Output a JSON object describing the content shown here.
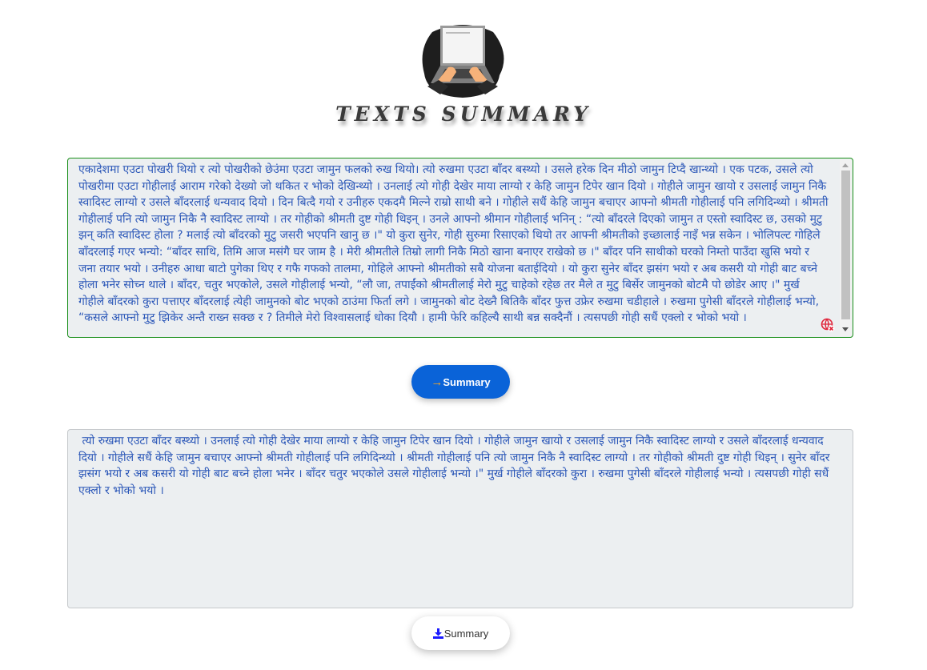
{
  "header": {
    "title": "TEXTS SUMMARY",
    "logo_icon": "laptop-typing-logo"
  },
  "input": {
    "text": "एकादेशमा एउटा पोखरी थियो र त्यो पोखरीको छेउंमा एउटा जामुन फलको रुख थियो। त्यो रुखमा एउटा बाँदर बस्थ्यो । उसले हरेक दिन मीठो जामुन टिप्दै खान्थ्यो । एक पटक, उसले त्यो पोखरीमा एउटा गोहीलाई आराम गरेको देख्यो जो थकित र भोको देखिन्थ्यो । उनलाई त्यो गोही देखेर माया लाग्यो र केहि जामुन टिपेर खान दियो । गोहीले जामुन खायो र उसलाई जामुन निकै स्वादिस्ट लाग्यो र उसले बाँदरलाई धन्यवाद दियो । दिन बित्दै गयो र उनीहरु एकदमै मिल्ने राम्रो साथी बने । गोहीले सधैं केहि जामुन बचाएर आफ्नो श्रीमती गोहीलाई पनि लगिदिन्थ्यो । श्रीमती गोहीलाई पनि त्यो जामुन निकै नै स्वादिस्ट लाग्यो । तर गोहीको श्रीमती दुष्ट गोही थिइन् । उनले आफ्नो श्रीमान गोहीलाई भनिन् : “त्यो बाँदरले दिएको जामुन त एस्तो स्वादिस्ट छ, उसको मुटु झन् कति स्वादिस्ट होला ? मलाई त्यो बाँदरको मुटु जसरी भएपनि खानु छ ।\" यो कुरा सुनेर, गोही सुरुमा रिसाएको थियो तर आफ्नी श्रीमतीको इच्छालाई नाइँ भन्न सकेन । भोलिपल्ट गोहिले बाँदरलाई गएर भन्यो: “बाँदर साथि, तिमि आज मसंगै घर जाम है । मेरी श्रीमतीले तिम्रो लागी निकै मिठो खाना बनाएर राखेको छ ।\" बाँदर पनि साथीको घरको निम्तो पाउँदा खुसि भयो र जना तयार भयो । उनीहरु आधा बाटो पुगेका थिए र गफै गफको तालमा, गोहिले आफ्नो श्रीमतीको सबै योजना बताईदियो । यो कुरा सुनेर बाँदर झसंग भयो र अब कसरी यो गोही बाट बच्ने होला भनेर सोच्न थाले । बाँदर, चतुर भएकोले, उसले गोहीलाई भन्यो, “लौ जा, तपाईंको श्रीमतीलाई मेरो मुटु चाहेको रहेछ तर मैले त मुटु बिर्सेर जामुनको बोटमै पो छोडेर आए ।\" मुर्ख गोहीले बाँदरको कुरा पत्ताएर बाँदरलाई त्येही जामुनको बोट भएको ठाउंमा फिर्ता लगे । जामुनको बोट देख्नै बितिकै बाँदर फुत्त उफ्रेर रुखमा चडीहाले । रुखमा पुगेसी बाँदरले गोहीलाई भन्यो, “कसले आफ्नो मुटु झिकेर अन्तै राख्न सक्छ र ? तिमीले मेरो विश्वासलाई धोका दियौ । हामी फेरि कहिल्यै साथी बन्न सक्दैनौं । त्यसपछी गोही सधैं एक्लो र भोको भयो ।",
    "grammar_icon": "language-check-icon"
  },
  "summarize_button": {
    "label": "Summary",
    "icon": "arrow-right-icon",
    "icon_glyph": "→",
    "icon_color": "#f5a623",
    "bg_color": "#0a63d8"
  },
  "output": {
    "text": " त्यो रुखमा एउटा बाँदर बस्थ्यो । उनलाई त्यो गोही देखेर माया लाग्यो र केहि जामुन टिपेर खान दियो । गोहीले जामुन खायो र उसलाई जामुन निकै स्वादिस्ट लाग्यो र उसले बाँदरलाई धन्यवाद दियो । गोहीले सधैं केहि जामुन बचाएर आफ्नो श्रीमती गोहीलाई पनि लगिदिन्थ्यो । श्रीमती गोहीलाई पनि त्यो जामुन निकै नै स्वादिस्ट लाग्यो । तर गोहीको श्रीमती दुष्ट गोही थिइन् । सुनेर बाँदर झसंग भयो र अब कसरी यो गोही बाट बच्ने होला भनेर । बाँदर चतुर भएकोले उसले गोहीलाई भन्यो ।\" मुर्ख गोहीले बाँदरको कुरा । रुखमा पुगेसी बाँदरले गोहीलाई भन्यो । त्यसपछी गोही सधैं एक्लो र भोको भयो ।"
  },
  "download_button": {
    "label": "Summary",
    "icon": "download-icon",
    "icon_color": "#1a1aff"
  }
}
